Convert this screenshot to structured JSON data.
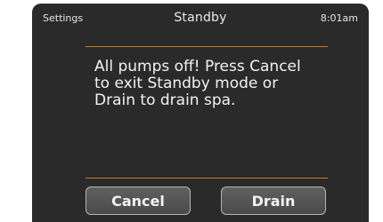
{
  "header": {
    "settings_label": "Settings",
    "title": "Standby",
    "time": "8:01am"
  },
  "message": "All pumps off! Press Cancel to exit Standby mode or Drain to drain spa.",
  "buttons": {
    "cancel": "Cancel",
    "drain": "Drain"
  },
  "colors": {
    "panel_background": "#2a2a2a",
    "divider_accent": "#c27a2c",
    "button_border": "#b4b4b4"
  }
}
